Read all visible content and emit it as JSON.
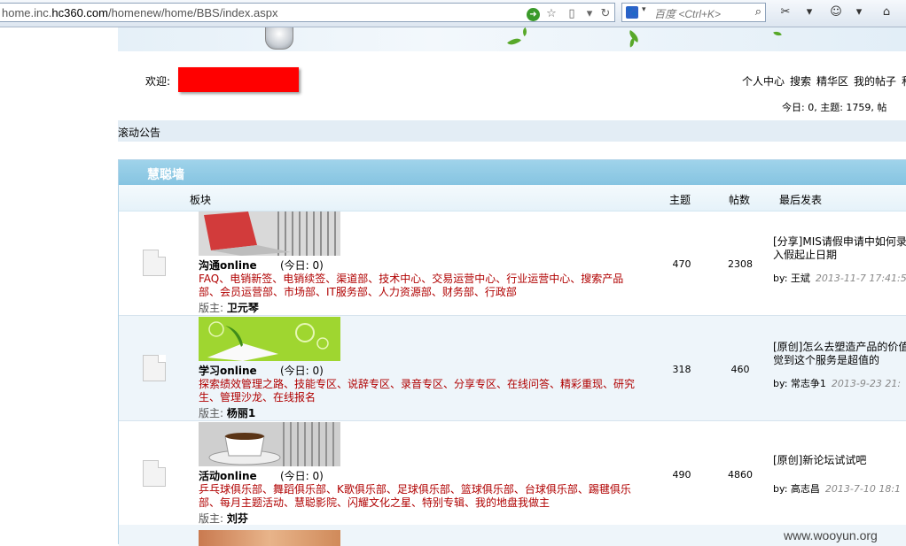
{
  "browser": {
    "url_prefix": "home.inc.",
    "url_domain": "hc360.com",
    "url_path": "/homenew/home/BBS/index.aspx",
    "search_placeholder": "百度 <Ctrl+K>"
  },
  "header": {
    "welcome_label": "欢迎:",
    "nav_items": [
      "个人中心",
      "搜索",
      "精华区",
      "我的帖子",
      "积"
    ],
    "stats": "今日: 0, 主题: 1759, 帖"
  },
  "announcement": {
    "label": "滚动公告"
  },
  "forum": {
    "title": "慧聪墙",
    "columns": {
      "board": "板块",
      "topics": "主题",
      "posts": "帖数",
      "last_post": "最后发表"
    },
    "rows": [
      {
        "name": "沟通online",
        "today": "(今日: 0)",
        "subforums": "FAQ、电销新签、电销续签、渠道部、技术中心、交易运营中心、行业运营中心、搜索产品部、会员运营部、市场部、IT服务部、人力资源部、财务部、行政部",
        "moderator_label": "版主:",
        "moderator": "卫元琴",
        "topics": "470",
        "posts": "2308",
        "last_title": "[分享]MIS请假申请中如何录入假起止日期",
        "last_by_label": "by:",
        "last_author": "王斌",
        "last_date": "2013-11-7 17:41:5"
      },
      {
        "name": "学习online",
        "today": "(今日: 0)",
        "subforums": "探索绩效管理之路、技能专区、说辞专区、录音专区、分享专区、在线问答、精彩重现、研究生、管理沙龙、在线报名",
        "moderator_label": "版主:",
        "moderator": "杨丽1",
        "topics": "318",
        "posts": "460",
        "last_title": "[原创]怎么去塑造产品的价值觉到这个服务是超值的",
        "last_by_label": "by:",
        "last_author": "常志争1",
        "last_date": "2013-9-23 21:"
      },
      {
        "name": "活动online",
        "today": "(今日: 0)",
        "subforums": "乒乓球俱乐部、舞蹈俱乐部、K歌俱乐部、足球俱乐部、篮球俱乐部、台球俱乐部、踢毽俱乐部、每月主题活动、慧聪影院、闪耀文化之星、特别专辑、我的地盘我做主",
        "moderator_label": "版主:",
        "moderator": "刘芬",
        "topics": "490",
        "posts": "4860",
        "last_title": "[原创]新论坛试试吧",
        "last_by_label": "by:",
        "last_author": "高志昌",
        "last_date": "2013-7-10 18:1"
      }
    ]
  },
  "watermark": "www.wooyun.org",
  "colors": {
    "section_header": "#8cc8e4",
    "link_red": "#b00000",
    "row_alt": "#eef5fa"
  }
}
